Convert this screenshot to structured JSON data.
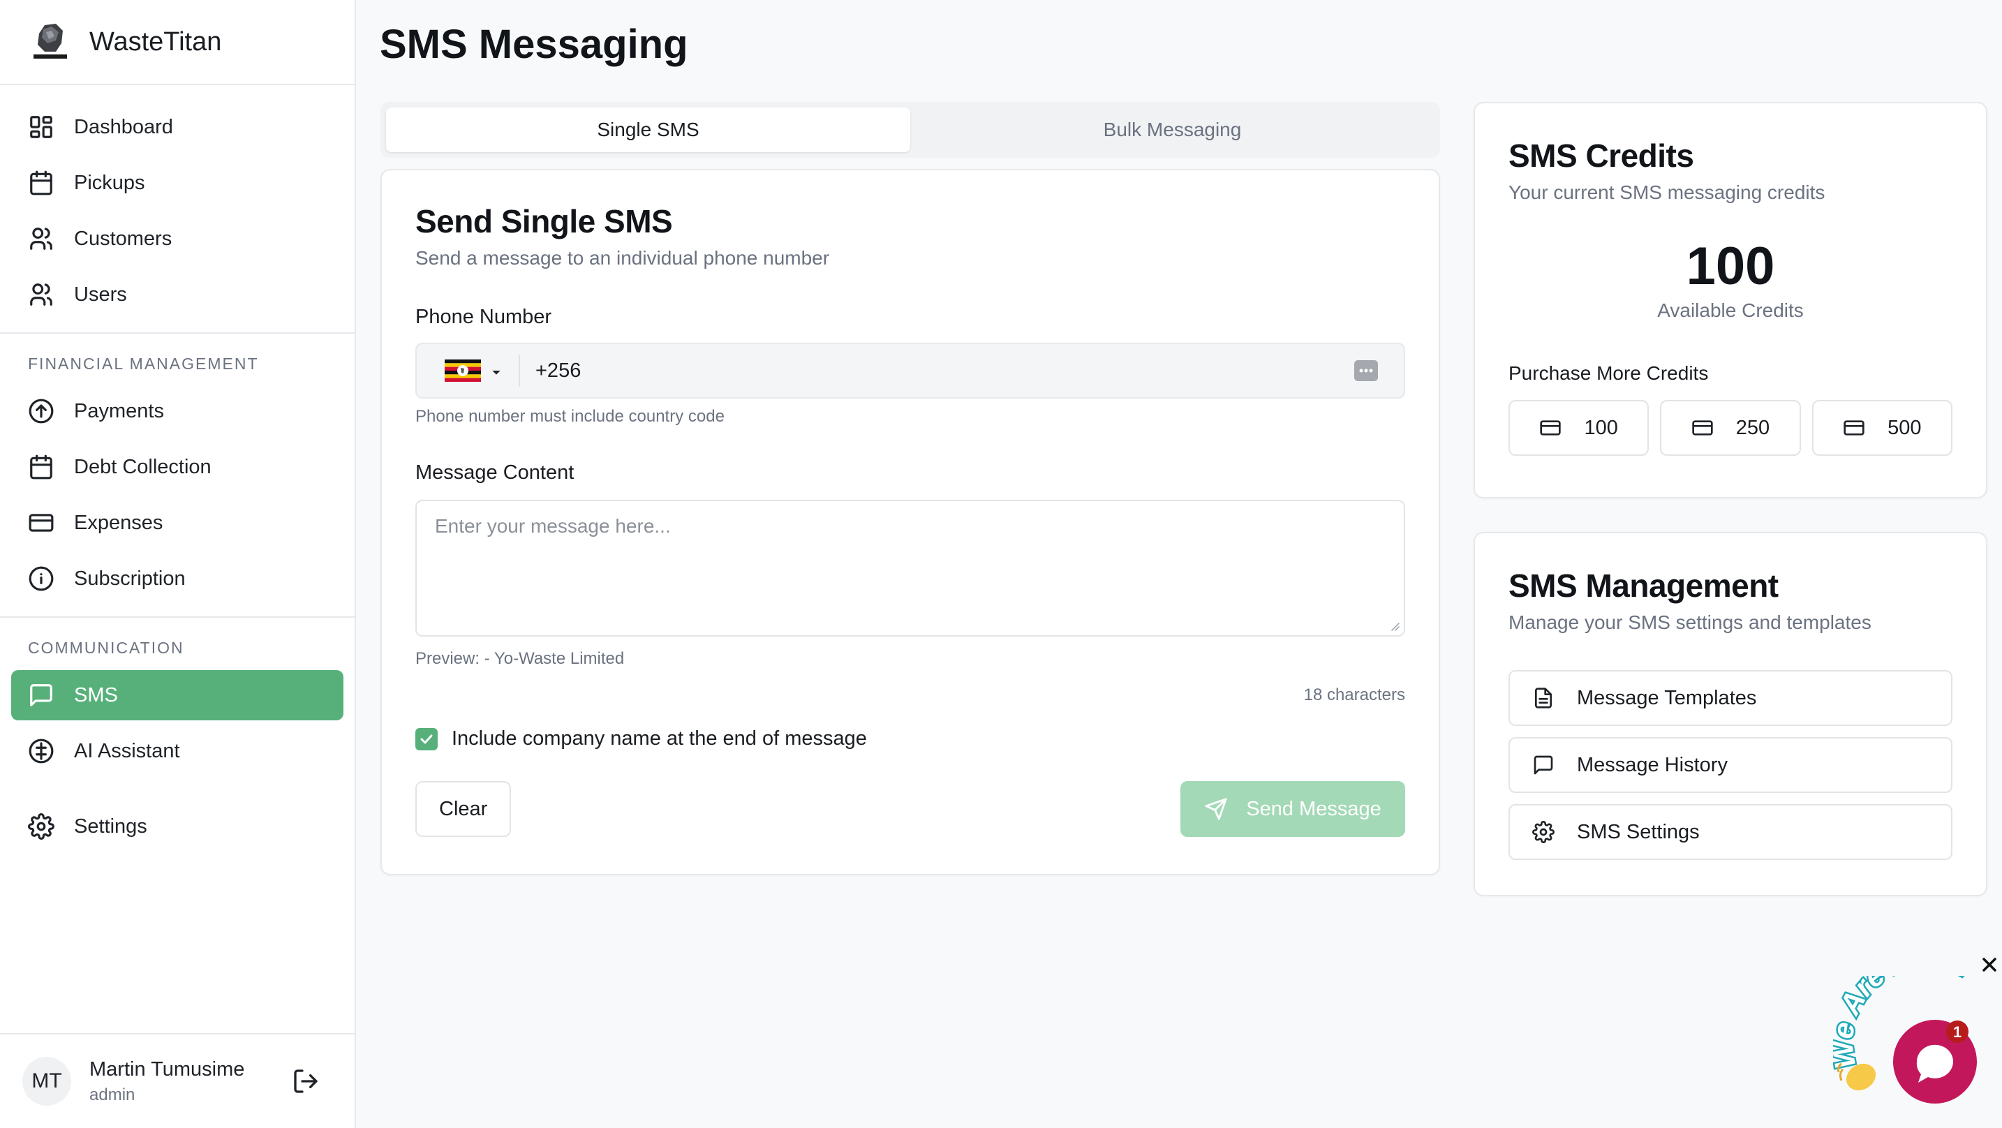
{
  "app": {
    "name": "WasteTitan"
  },
  "sidebar": {
    "main_items": [
      {
        "label": "Dashboard",
        "icon": "dashboard-icon"
      },
      {
        "label": "Pickups",
        "icon": "calendar-icon"
      },
      {
        "label": "Customers",
        "icon": "users-icon"
      },
      {
        "label": "Users",
        "icon": "users-icon"
      }
    ],
    "financial": {
      "heading": "FINANCIAL MANAGEMENT",
      "items": [
        {
          "label": "Payments",
          "icon": "circle-arrow-up-icon"
        },
        {
          "label": "Debt Collection",
          "icon": "calendar-icon"
        },
        {
          "label": "Expenses",
          "icon": "credit-card-icon"
        },
        {
          "label": "Subscription",
          "icon": "info-circle-icon"
        }
      ]
    },
    "communication": {
      "heading": "COMMUNICATION",
      "items": [
        {
          "label": "SMS",
          "icon": "message-square-icon",
          "active": true
        },
        {
          "label": "AI Assistant",
          "icon": "circle-dollar-icon"
        }
      ]
    },
    "settings_label": "Settings",
    "user": {
      "initials": "MT",
      "name": "Martin Tumusime",
      "role": "admin"
    }
  },
  "page": {
    "title": "SMS Messaging"
  },
  "tabs": [
    {
      "label": "Single SMS",
      "active": true
    },
    {
      "label": "Bulk Messaging",
      "active": false
    }
  ],
  "single_sms": {
    "title": "Send Single SMS",
    "subtitle": "Send a message to an individual phone number",
    "phone_label": "Phone Number",
    "phone_value": "+256",
    "phone_helper": "Phone number must include country code",
    "message_label": "Message Content",
    "message_placeholder": "Enter your message here...",
    "preview": "Preview:  - Yo-Waste Limited",
    "char_count": "18 characters",
    "include_company_label": "Include company name at the end of message",
    "include_company_checked": true,
    "clear_label": "Clear",
    "send_label": "Send Message"
  },
  "credits": {
    "title": "SMS Credits",
    "subtitle": "Your current SMS messaging credits",
    "available": "100",
    "available_label": "Available Credits",
    "purchase_label": "Purchase More Credits",
    "options": [
      "100",
      "250",
      "500"
    ]
  },
  "management": {
    "title": "SMS Management",
    "subtitle": "Manage your SMS settings and templates",
    "items": [
      {
        "label": "Message Templates",
        "icon": "file-text-icon"
      },
      {
        "label": "Message History",
        "icon": "message-square-icon"
      },
      {
        "label": "SMS Settings",
        "icon": "gear-icon"
      }
    ]
  },
  "chat_widget": {
    "text": "We Are Here!",
    "badge": "1"
  },
  "colors": {
    "accent": "#57b07a",
    "accent_light": "#a3d9b6",
    "chat": "#c2185b"
  }
}
